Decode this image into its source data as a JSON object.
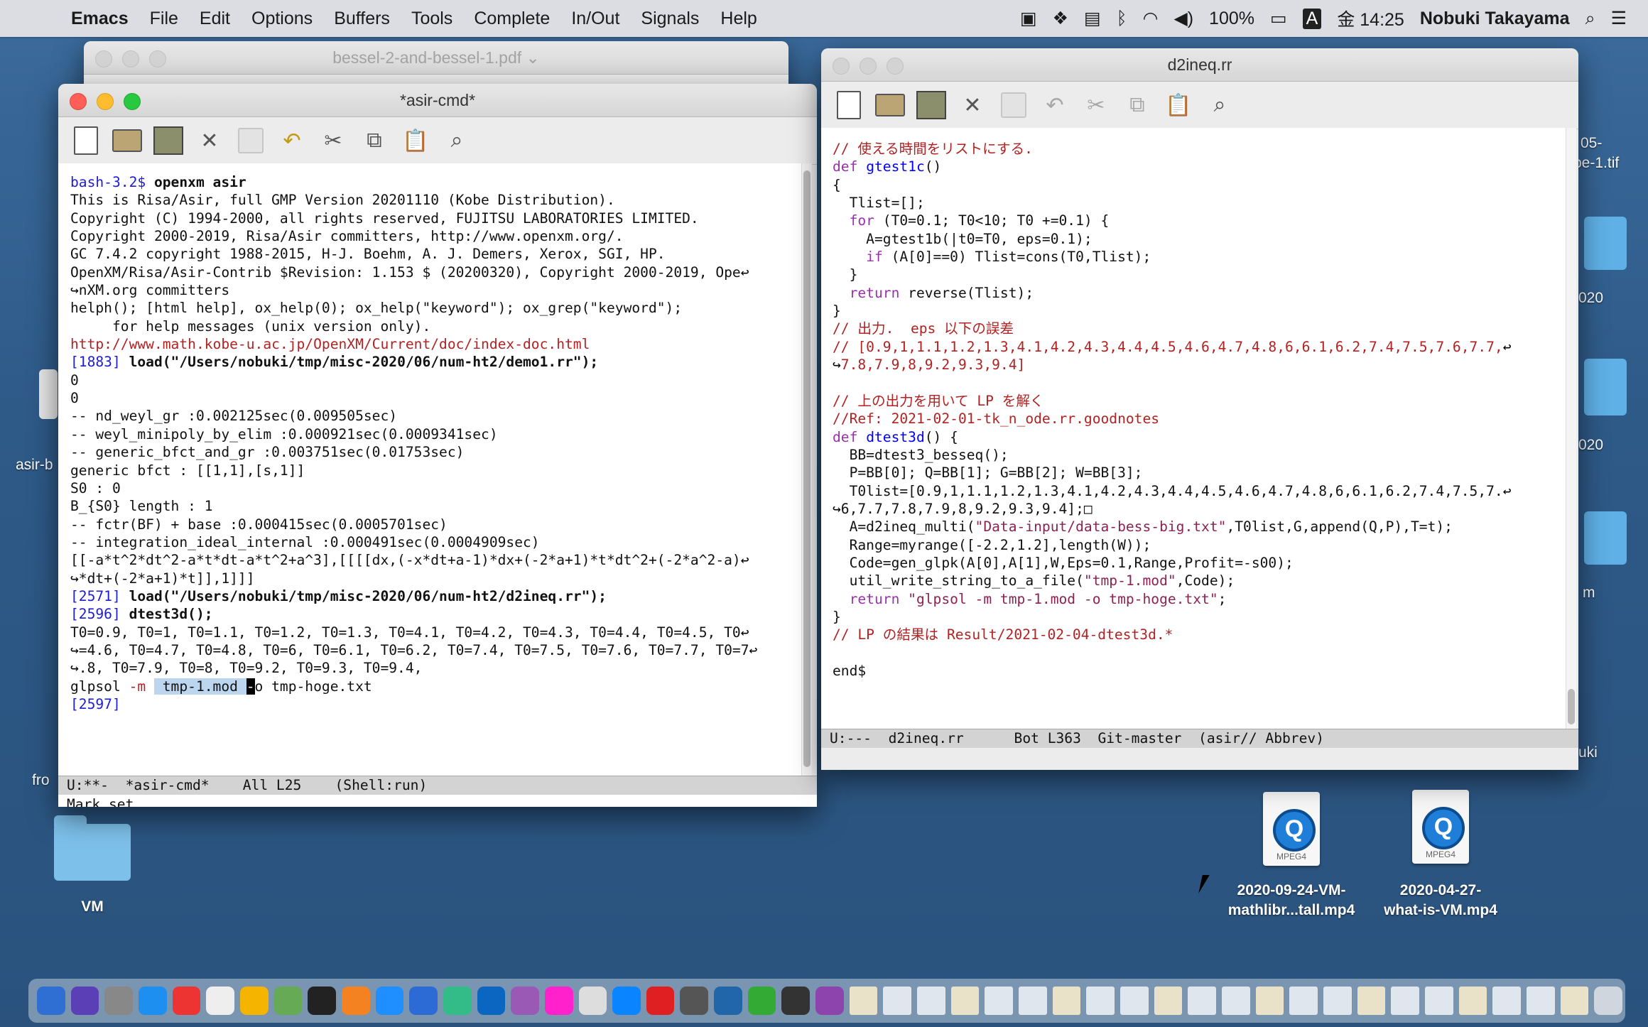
{
  "menubar": {
    "apple": "",
    "app": "Emacs",
    "items": [
      "File",
      "Edit",
      "Options",
      "Buffers",
      "Tools",
      "Complete",
      "In/Out",
      "Signals",
      "Help"
    ],
    "battery": "100%",
    "input_source": "A",
    "time": "金 14:25",
    "user": "Nobuki Takayama"
  },
  "pdf_window": {
    "title": "bessel-2-and-bessel-1.pdf ⌄"
  },
  "asir_window": {
    "title": "*asir-cmd*",
    "lines": [
      [
        [
          "pr",
          "bash-3.2$ "
        ],
        [
          "bd",
          "openxm asir"
        ]
      ],
      [
        [
          "",
          "This is Risa/Asir, full GMP Version 20201110 (Kobe Distribution)."
        ]
      ],
      [
        [
          "",
          "Copyright (C) 1994-2000, all rights reserved, FUJITSU LABORATORIES LIMITED."
        ]
      ],
      [
        [
          "",
          "Copyright 2000-2019, Risa/Asir committers, http://www.openxm.org/."
        ]
      ],
      [
        [
          "",
          "GC 7.4.2 copyright 1988-2015, H-J. Boehm, A. J. Demers, Xerox, SGI, HP."
        ]
      ],
      [
        [
          "",
          "OpenXM/Risa/Asir-Contrib $Revision: 1.153 $ (20200320), Copyright 2000-2019, Ope"
        ],
        [
          "ret",
          "↩"
        ]
      ],
      [
        [
          "ret",
          "↪"
        ],
        [
          "",
          "nXM.org committers"
        ]
      ],
      [
        [
          "",
          "helph(); [html help], ox_help(0); ox_help(\"keyword\"); ox_grep(\"keyword\");"
        ]
      ],
      [
        [
          "",
          "     for help messages (unix version only)."
        ]
      ],
      [
        [
          "cm",
          "http://www.math.kobe-u.ac.jp/OpenXM/Current/doc/index-doc.html"
        ]
      ],
      [
        [
          "pr",
          "[1883] "
        ],
        [
          "bd",
          "load(\"/Users/nobuki/tmp/misc-2020/06/num-ht2/demo1.rr\");"
        ]
      ],
      [
        [
          "",
          "0"
        ]
      ],
      [
        [
          "",
          "0"
        ]
      ],
      [
        [
          "",
          "-- nd_weyl_gr :0.002125sec(0.009505sec)"
        ]
      ],
      [
        [
          "",
          "-- weyl_minipoly_by_elim :0.000921sec(0.0009341sec)"
        ]
      ],
      [
        [
          "",
          "-- generic_bfct_and_gr :0.003751sec(0.01753sec)"
        ]
      ],
      [
        [
          "",
          "generic bfct : [[1,1],[s,1]]"
        ]
      ],
      [
        [
          "",
          "S0 : 0"
        ]
      ],
      [
        [
          "",
          "B_{S0} length : 1"
        ]
      ],
      [
        [
          "",
          "-- fctr(BF) + base :0.000415sec(0.0005701sec)"
        ]
      ],
      [
        [
          "",
          "-- integration_ideal_internal :0.000491sec(0.0004909sec)"
        ]
      ],
      [
        [
          "",
          "[[-a*t^2*dt^2-a*t*dt-a*t^2+a^3],[[[[dx,(-x*dt+a-1)*dx+(-2*a+1)*t*dt^2+(-2*a^2-a)"
        ],
        [
          "ret",
          "↩"
        ]
      ],
      [
        [
          "ret",
          "↪"
        ],
        [
          "",
          "*dt+(-2*a+1)*t]],1]]]"
        ]
      ],
      [
        [
          "pr",
          "[2571] "
        ],
        [
          "bd",
          "load(\"/Users/nobuki/tmp/misc-2020/06/num-ht2/d2ineq.rr\");"
        ]
      ],
      [
        [
          "pr",
          "[2596] "
        ],
        [
          "bd",
          "dtest3d();"
        ]
      ],
      [
        [
          "",
          "T0=0.9, T0=1, T0=1.1, T0=1.2, T0=1.3, T0=4.1, T0=4.2, T0=4.3, T0=4.4, T0=4.5, T0"
        ],
        [
          "ret",
          "↩"
        ]
      ],
      [
        [
          "ret",
          "↪"
        ],
        [
          "",
          "=4.6, T0=4.7, T0=4.8, T0=6, T0=6.1, T0=6.2, T0=7.4, T0=7.5, T0=7.6, T0=7.7, T0=7"
        ],
        [
          "ret",
          "↩"
        ]
      ],
      [
        [
          "ret",
          "↪"
        ],
        [
          "",
          ".8, T0=7.9, T0=8, T0=9.2, T0=9.3, T0=9.4,"
        ]
      ],
      [
        [
          "",
          "glpsol "
        ],
        [
          "cm",
          "-m "
        ],
        [
          "hl",
          " tmp-1.mod "
        ],
        [
          "cursor",
          "-"
        ],
        [
          "",
          "o tmp-hoge.txt"
        ]
      ],
      [
        [
          "pr",
          "[2597] "
        ]
      ]
    ],
    "modeline": "U:**-  *asir-cmd*    All L25    (Shell:run)",
    "echo": "Mark set"
  },
  "d2_window": {
    "title": "d2ineq.rr",
    "lines": [
      [
        [
          "cm",
          "// 使える時間をリストにする."
        ]
      ],
      [
        [
          "kw",
          "def "
        ],
        [
          "fn",
          "gtest1c"
        ],
        [
          "",
          "()"
        ]
      ],
      [
        [
          "",
          "{"
        ]
      ],
      [
        [
          "",
          "  Tlist=[];"
        ]
      ],
      [
        [
          "",
          "  "
        ],
        [
          "kw",
          "for"
        ],
        [
          "",
          " (T0=0.1; T0<10; T0 +=0.1) {"
        ]
      ],
      [
        [
          "",
          "    A=gtest1b(|t0=T0, eps=0.1);"
        ]
      ],
      [
        [
          "",
          "    "
        ],
        [
          "kw",
          "if"
        ],
        [
          "",
          " (A[0]==0) Tlist=cons(T0,Tlist);"
        ]
      ],
      [
        [
          "",
          "  }"
        ]
      ],
      [
        [
          "",
          "  "
        ],
        [
          "kw",
          "return"
        ],
        [
          "",
          " reverse(Tlist);"
        ]
      ],
      [
        [
          "",
          "}"
        ]
      ],
      [
        [
          "cm",
          "// 出力.  eps 以下の誤差"
        ]
      ],
      [
        [
          "cm",
          "// [0.9,1,1.1,1.2,1.3,4.1,4.2,4.3,4.4,4.5,4.6,4.7,4.8,6,6.1,6.2,7.4,7.5,7.6,7.7,"
        ],
        [
          "ret",
          "↩"
        ]
      ],
      [
        [
          "ret",
          "↪"
        ],
        [
          "cm",
          "7.8,7.9,8,9.2,9.3,9.4]"
        ]
      ],
      [
        [
          "",
          ""
        ]
      ],
      [
        [
          "cm",
          "// 上の出力を用いて LP を解く"
        ]
      ],
      [
        [
          "cm",
          "//Ref: 2021-02-01-tk_n_ode.rr.goodnotes"
        ]
      ],
      [
        [
          "kw",
          "def "
        ],
        [
          "fn",
          "dtest3d"
        ],
        [
          "",
          "() {"
        ]
      ],
      [
        [
          "",
          "  BB=dtest3_besseq();"
        ]
      ],
      [
        [
          "",
          "  P=BB[0]; Q=BB[1]; G=BB[2]; W=BB[3];"
        ]
      ],
      [
        [
          "",
          "  T0list=[0.9,1,1.1,1.2,1.3,4.1,4.2,4.3,4.4,4.5,4.6,4.7,4.8,6,6.1,6.2,7.4,7.5,7."
        ],
        [
          "ret",
          "↩"
        ]
      ],
      [
        [
          "ret",
          "↪"
        ],
        [
          "",
          "6,7.7,7.8,7.9,8,9.2,9.3,9.4];□"
        ]
      ],
      [
        [
          "",
          "  A=d2ineq_multi("
        ],
        [
          "st",
          "\"Data-input/data-bess-big.txt\""
        ],
        [
          "",
          ",T0list,G,append(Q,P),T=t);"
        ]
      ],
      [
        [
          "",
          "  Range=myrange([-2.2,1.2],length(W));"
        ]
      ],
      [
        [
          "",
          "  Code=gen_glpk(A[0],A[1],W,Eps=0.1,Range,Profit=-s00);"
        ]
      ],
      [
        [
          "",
          "  util_write_string_to_a_file("
        ],
        [
          "st",
          "\"tmp-1.mod\""
        ],
        [
          "",
          ",Code);"
        ]
      ],
      [
        [
          "",
          "  "
        ],
        [
          "kw",
          "return"
        ],
        [
          "",
          " "
        ],
        [
          "st",
          "\"glpsol -m tmp-1.mod -o tmp-hoge.txt\""
        ],
        [
          "",
          ";"
        ]
      ],
      [
        [
          "",
          "}"
        ]
      ],
      [
        [
          "cm",
          "// LP の結果は Result/2021-02-04-dtest3d.*"
        ]
      ],
      [
        [
          "",
          ""
        ]
      ],
      [
        [
          "",
          "end$"
        ]
      ]
    ],
    "modeline": "U:---  d2ineq.rr      Bot L363  Git-master  (asir// Abbrev)"
  },
  "desktop": {
    "folder_label": "VM",
    "file1": {
      "line1": "2020-09-24-VM-",
      "line2": "mathlibr...tall.mp4",
      "tag": "MPEG4"
    },
    "file2": {
      "line1": "2020-04-27-",
      "line2": "what-is-VM.mp4",
      "tag": "MPEG4"
    },
    "edge_texts": [
      "05-",
      "pe-1.tif",
      "020",
      "020",
      "m",
      "uki",
      "asir-b",
      "fro"
    ]
  },
  "colors": {
    "keyword": "#9b2fae",
    "comment": "#b22222",
    "string": "#8b2252",
    "function": "#0000ff",
    "prompt": "#1c1cd6"
  }
}
